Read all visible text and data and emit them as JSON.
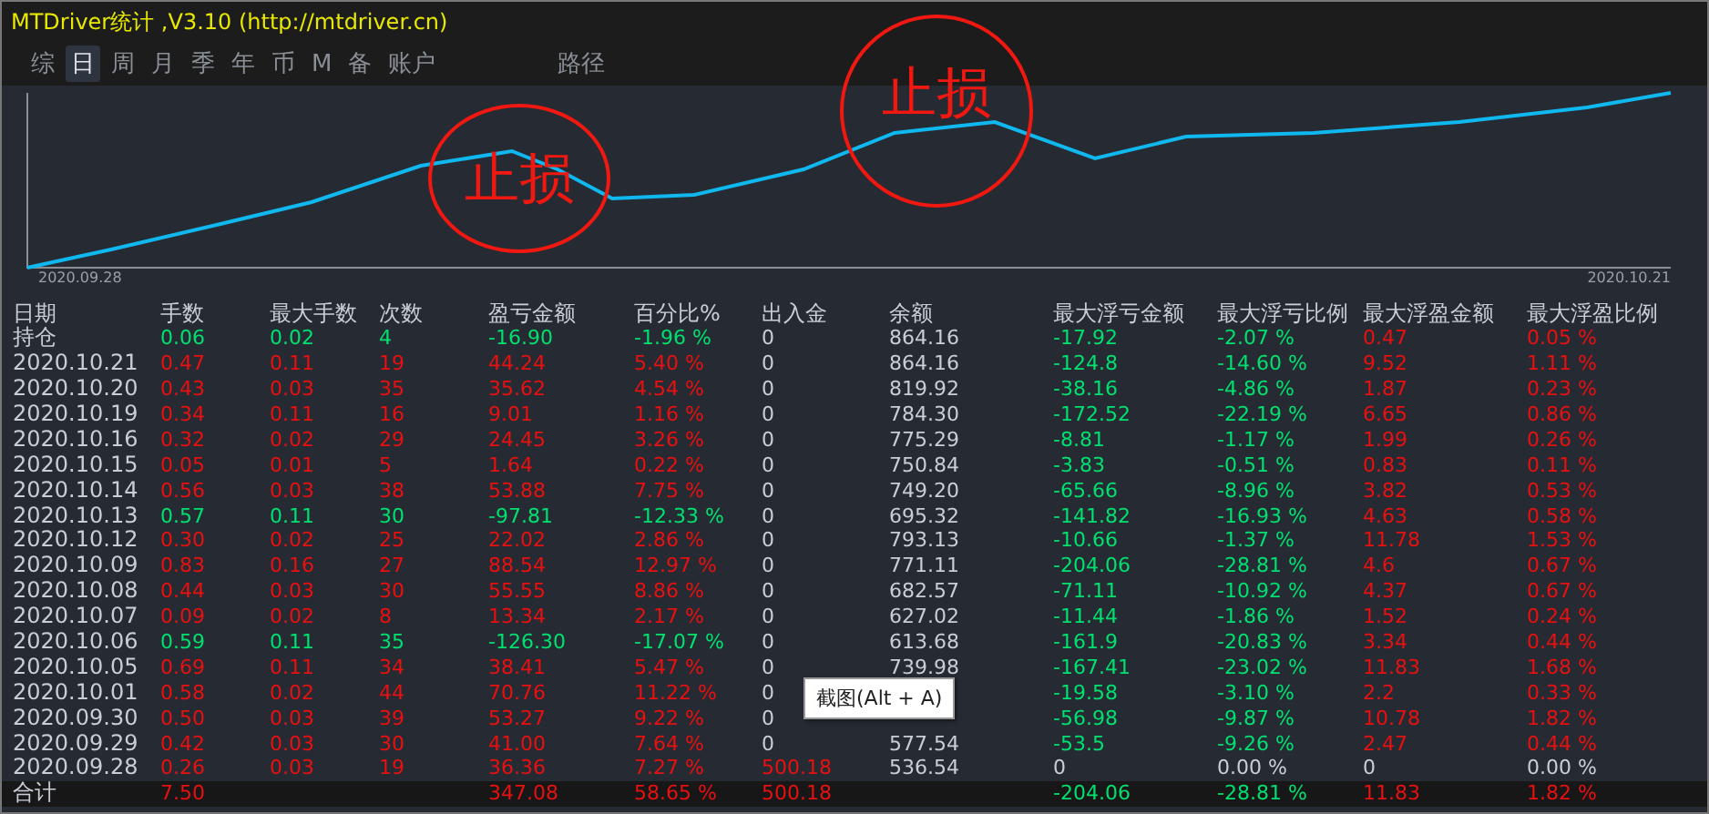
{
  "window": {
    "title": "MTDriver统计 ,V3.10 (http://mtdriver.cn)"
  },
  "tabs": [
    {
      "label": "综",
      "selected": false
    },
    {
      "label": "日",
      "selected": true
    },
    {
      "label": "周",
      "selected": false
    },
    {
      "label": "月",
      "selected": false
    },
    {
      "label": "季",
      "selected": false
    },
    {
      "label": "年",
      "selected": false
    },
    {
      "label": "币",
      "selected": false
    },
    {
      "label": "M",
      "selected": false
    },
    {
      "label": "备",
      "selected": false
    },
    {
      "label": "账户",
      "selected": false
    },
    {
      "label": "路径",
      "selected": false
    }
  ],
  "chart": {
    "start_label": "2020.09.28",
    "end_label": "2020.10.21",
    "annotations": [
      "止损",
      "止损"
    ]
  },
  "table": {
    "columns": [
      {
        "label": "日期",
        "kind": "plain"
      },
      {
        "label": "手数",
        "kind": "result"
      },
      {
        "label": "最大手数",
        "kind": "result"
      },
      {
        "label": "次数",
        "kind": "result"
      },
      {
        "label": "盈亏金额",
        "kind": "result"
      },
      {
        "label": "百分比%",
        "kind": "result"
      },
      {
        "label": "出入金",
        "kind": "deposit"
      },
      {
        "label": "余额",
        "kind": "plain"
      },
      {
        "label": "最大浮亏金额",
        "kind": "loss"
      },
      {
        "label": "最大浮亏比例",
        "kind": "loss"
      },
      {
        "label": "最大浮盈金额",
        "kind": "gain"
      },
      {
        "label": "最大浮盈比例",
        "kind": "gain"
      }
    ],
    "rows": [
      {
        "loss": true,
        "deposit": false,
        "float_zero": false,
        "cells": [
          "持仓",
          "0.06",
          "0.02",
          "4",
          "-16.90",
          "-1.96 %",
          "0",
          "864.16",
          "-17.92",
          "-2.07 %",
          "0.47",
          "0.05 %"
        ]
      },
      {
        "loss": false,
        "deposit": false,
        "float_zero": false,
        "cells": [
          "2020.10.21",
          "0.47",
          "0.11",
          "19",
          "44.24",
          "5.40 %",
          "0",
          "864.16",
          "-124.8",
          "-14.60 %",
          "9.52",
          "1.11 %"
        ]
      },
      {
        "loss": false,
        "deposit": false,
        "float_zero": false,
        "cells": [
          "2020.10.20",
          "0.43",
          "0.03",
          "35",
          "35.62",
          "4.54 %",
          "0",
          "819.92",
          "-38.16",
          "-4.86 %",
          "1.87",
          "0.23 %"
        ]
      },
      {
        "loss": false,
        "deposit": false,
        "float_zero": false,
        "cells": [
          "2020.10.19",
          "0.34",
          "0.11",
          "16",
          "9.01",
          "1.16 %",
          "0",
          "784.30",
          "-172.52",
          "-22.19 %",
          "6.65",
          "0.86 %"
        ]
      },
      {
        "loss": false,
        "deposit": false,
        "float_zero": false,
        "cells": [
          "2020.10.16",
          "0.32",
          "0.02",
          "29",
          "24.45",
          "3.26 %",
          "0",
          "775.29",
          "-8.81",
          "-1.17 %",
          "1.99",
          "0.26 %"
        ]
      },
      {
        "loss": false,
        "deposit": false,
        "float_zero": false,
        "cells": [
          "2020.10.15",
          "0.05",
          "0.01",
          "5",
          "1.64",
          "0.22 %",
          "0",
          "750.84",
          "-3.83",
          "-0.51 %",
          "0.83",
          "0.11 %"
        ]
      },
      {
        "loss": false,
        "deposit": false,
        "float_zero": false,
        "cells": [
          "2020.10.14",
          "0.56",
          "0.03",
          "38",
          "53.88",
          "7.75 %",
          "0",
          "749.20",
          "-65.66",
          "-8.96 %",
          "3.82",
          "0.53 %"
        ]
      },
      {
        "loss": true,
        "deposit": false,
        "float_zero": false,
        "cells": [
          "2020.10.13",
          "0.57",
          "0.11",
          "30",
          "-97.81",
          "-12.33 %",
          "0",
          "695.32",
          "-141.82",
          "-16.93 %",
          "4.63",
          "0.58 %"
        ]
      },
      {
        "loss": false,
        "deposit": false,
        "float_zero": false,
        "cells": [
          "2020.10.12",
          "0.30",
          "0.02",
          "25",
          "22.02",
          "2.86 %",
          "0",
          "793.13",
          "-10.66",
          "-1.37 %",
          "11.78",
          "1.53 %"
        ]
      },
      {
        "loss": false,
        "deposit": false,
        "float_zero": false,
        "cells": [
          "2020.10.09",
          "0.83",
          "0.16",
          "27",
          "88.54",
          "12.97 %",
          "0",
          "771.11",
          "-204.06",
          "-28.81 %",
          "4.6",
          "0.67 %"
        ]
      },
      {
        "loss": false,
        "deposit": false,
        "float_zero": false,
        "cells": [
          "2020.10.08",
          "0.44",
          "0.03",
          "30",
          "55.55",
          "8.86 %",
          "0",
          "682.57",
          "-71.11",
          "-10.92 %",
          "4.37",
          "0.67 %"
        ]
      },
      {
        "loss": false,
        "deposit": false,
        "float_zero": false,
        "cells": [
          "2020.10.07",
          "0.09",
          "0.02",
          "8",
          "13.34",
          "2.17 %",
          "0",
          "627.02",
          "-11.44",
          "-1.86 %",
          "1.52",
          "0.24 %"
        ]
      },
      {
        "loss": true,
        "deposit": false,
        "float_zero": false,
        "cells": [
          "2020.10.06",
          "0.59",
          "0.11",
          "35",
          "-126.30",
          "-17.07 %",
          "0",
          "613.68",
          "-161.9",
          "-20.83 %",
          "3.34",
          "0.44 %"
        ]
      },
      {
        "loss": false,
        "deposit": false,
        "float_zero": false,
        "cells": [
          "2020.10.05",
          "0.69",
          "0.11",
          "34",
          "38.41",
          "5.47 %",
          "0",
          "739.98",
          "-167.41",
          "-23.02 %",
          "11.83",
          "1.68 %"
        ]
      },
      {
        "loss": false,
        "deposit": false,
        "float_zero": false,
        "cells": [
          "2020.10.01",
          "0.58",
          "0.02",
          "44",
          "70.76",
          "11.22 %",
          "0",
          null,
          "-19.58",
          "-3.10 %",
          "2.2",
          "0.33 %"
        ]
      },
      {
        "loss": false,
        "deposit": false,
        "float_zero": false,
        "cells": [
          "2020.09.30",
          "0.50",
          "0.03",
          "39",
          "53.27",
          "9.22 %",
          "0",
          null,
          "-56.98",
          "-9.87 %",
          "10.78",
          "1.82 %"
        ]
      },
      {
        "loss": false,
        "deposit": false,
        "float_zero": false,
        "cells": [
          "2020.09.29",
          "0.42",
          "0.03",
          "30",
          "41.00",
          "7.64 %",
          "0",
          "577.54",
          "-53.5",
          "-9.26 %",
          "2.47",
          "0.44 %"
        ]
      },
      {
        "loss": false,
        "deposit": true,
        "float_zero": true,
        "cells": [
          "2020.09.28",
          "0.26",
          "0.03",
          "19",
          "36.36",
          "7.27 %",
          "500.18",
          "536.54",
          "0",
          "0.00 %",
          "0",
          "0.00 %"
        ]
      }
    ],
    "total": {
      "loss": false,
      "deposit": true,
      "float_zero": false,
      "cells": [
        "合计",
        "7.50",
        null,
        null,
        "347.08",
        "58.65 %",
        "500.18",
        null,
        "-204.06",
        "-28.81 %",
        "11.83",
        "1.82 %"
      ]
    }
  },
  "tooltip": {
    "text": "截图(Alt + A)"
  }
}
